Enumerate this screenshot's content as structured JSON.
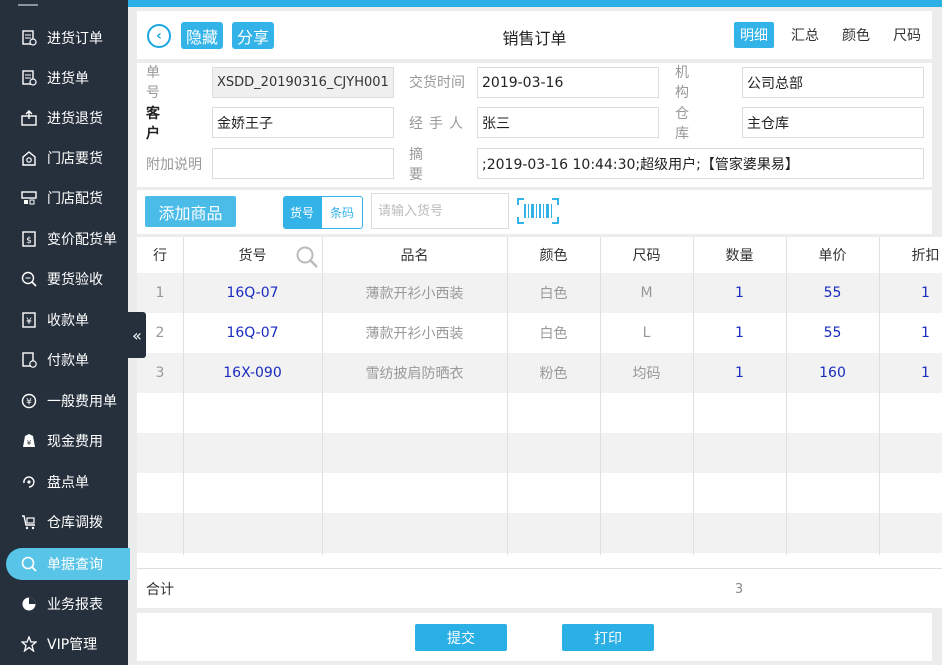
{
  "sidebar": {
    "items": [
      {
        "label": "进货订单",
        "icon": "purchase-order-icon"
      },
      {
        "label": "进货单",
        "icon": "purchase-icon"
      },
      {
        "label": "进货退货",
        "icon": "purchase-return-icon"
      },
      {
        "label": "门店要货",
        "icon": "store-request-icon"
      },
      {
        "label": "门店配货",
        "icon": "store-distribution-icon"
      },
      {
        "label": "变价配货单",
        "icon": "price-change-icon"
      },
      {
        "label": "要货验收",
        "icon": "request-check-icon"
      },
      {
        "label": "收款单",
        "icon": "receipt-icon"
      },
      {
        "label": "付款单",
        "icon": "payment-icon"
      },
      {
        "label": "一般费用单",
        "icon": "expense-icon"
      },
      {
        "label": "现金费用",
        "icon": "cash-expense-icon"
      },
      {
        "label": "盘点单",
        "icon": "inventory-count-icon"
      },
      {
        "label": "仓库调拨",
        "icon": "warehouse-transfer-icon"
      },
      {
        "label": "单据查询",
        "icon": "document-search-icon"
      },
      {
        "label": "业务报表",
        "icon": "report-icon"
      },
      {
        "label": "VIP管理",
        "icon": "vip-icon"
      }
    ],
    "active_index": 13
  },
  "header": {
    "hide_label": "隐藏",
    "share_label": "分享",
    "title": "销售订单",
    "tabs": [
      "明细",
      "汇总",
      "颜色",
      "尺码"
    ],
    "active_tab": 0
  },
  "form": {
    "order_no_label": "单号",
    "order_no": "XSDD_20190316_CJYH001",
    "delivery_time_label": "交货时间",
    "delivery_time": "2019-03-16",
    "org_label": "机构",
    "org": "公司总部",
    "customer_label": "客户",
    "customer": "金娇王子",
    "handler_label": "经手人",
    "handler": "张三",
    "warehouse_label": "仓库",
    "warehouse": "主仓库",
    "note_label": "附加说明",
    "note": "",
    "summary_label": "摘要",
    "summary": ";2019-03-16 10:44:30;超级用户;【管家婆果易】"
  },
  "toolbar": {
    "add_label": "添加商品",
    "seg_huohao": "货号",
    "seg_tiaoma": "条码",
    "code_placeholder": "请输入货号"
  },
  "table": {
    "columns": [
      "行",
      "货号",
      "品名",
      "颜色",
      "尺码",
      "数量",
      "单价",
      "折扣"
    ],
    "rows": [
      {
        "line": "1",
        "code": "16Q-07",
        "name": "薄款开衫小西装",
        "color": "白色",
        "size": "M",
        "qty": "1",
        "price": "55",
        "discount": "1"
      },
      {
        "line": "2",
        "code": "16Q-07",
        "name": "薄款开衫小西装",
        "color": "白色",
        "size": "L",
        "qty": "1",
        "price": "55",
        "discount": "1"
      },
      {
        "line": "3",
        "code": "16X-090",
        "name": "雪纺披肩防晒衣",
        "color": "粉色",
        "size": "均码",
        "qty": "1",
        "price": "160",
        "discount": "1"
      }
    ],
    "total_label": "合计",
    "total_qty": "3"
  },
  "footer": {
    "submit_label": "提交",
    "print_label": "打印"
  },
  "colors": {
    "sidebar_bg": "#26303c",
    "accent": "#34b3e8",
    "active_item": "#58c4e8",
    "code_text": "#1a2bc0"
  }
}
